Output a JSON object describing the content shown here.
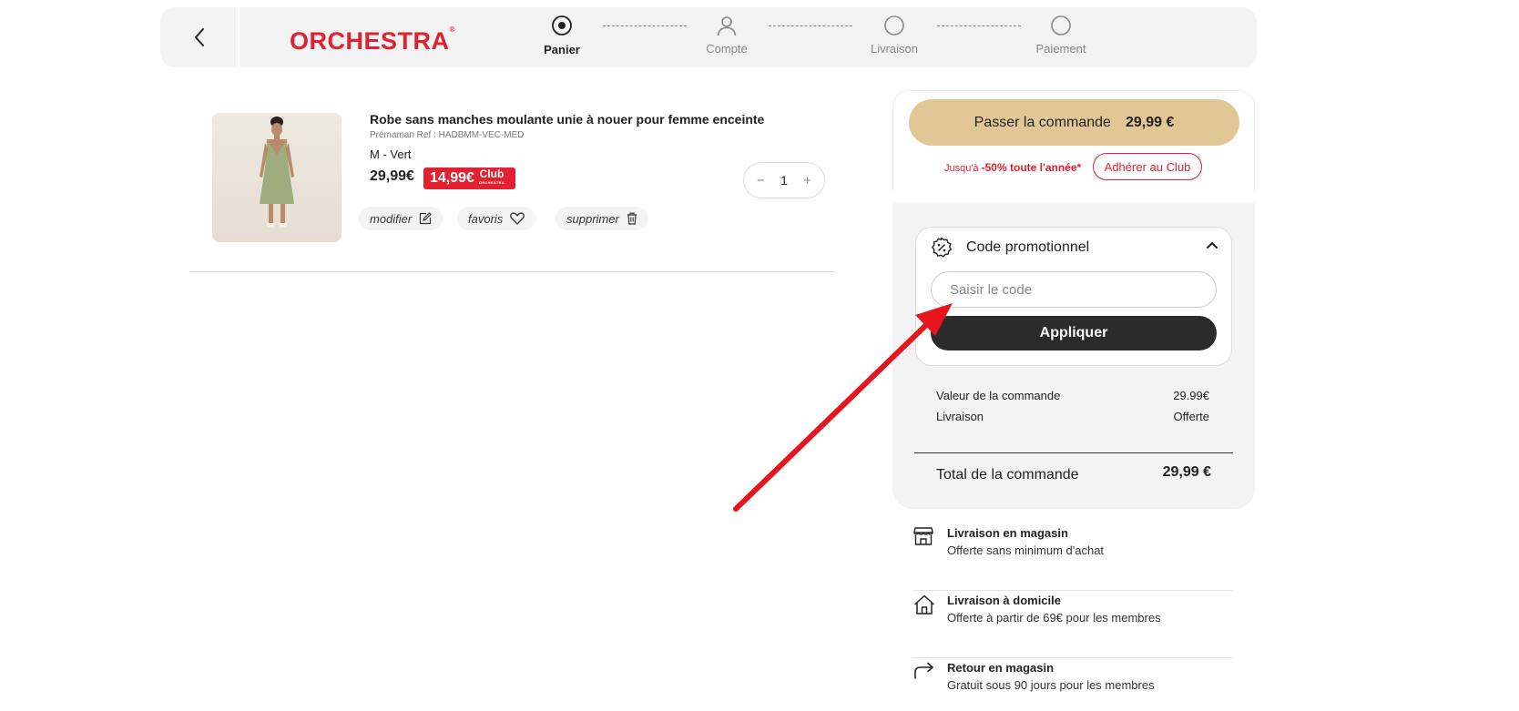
{
  "header": {
    "back_label": "Retour",
    "logo": "ORCHESTRA",
    "logo_mark": "®",
    "steps": [
      {
        "label": "Panier",
        "state": "active"
      },
      {
        "label": "Compte",
        "state": "inactive"
      },
      {
        "label": "Livraison",
        "state": "inactive"
      },
      {
        "label": "Paiement",
        "state": "inactive"
      }
    ]
  },
  "cart_item": {
    "title": "Robe sans manches moulante unie à nouer pour femme enceinte",
    "ref": "Prémaman Ref : HADBMM-VEC-MED",
    "variant": "M - Vert",
    "price": "29,99€",
    "club_price": "14,99€",
    "club_tag": "Club",
    "club_tag_brand": "ORCHESTRA",
    "quantity": "1",
    "qty_minus": "−",
    "qty_plus": "+",
    "actions": {
      "modify": "modifier",
      "favorites": "favoris",
      "remove": "supprimer"
    }
  },
  "checkout": {
    "button_label": "Passer la commande",
    "button_amount": "29,99 €",
    "club_promo_prefix": "Jusqu'à",
    "club_promo_highlight": "-50% toute l'année*",
    "club_button": "Adhérer au Club"
  },
  "promo": {
    "title": "Code promotionnel",
    "input_placeholder": "Saisir le code",
    "input_value": "",
    "apply_label": "Appliquer"
  },
  "summary": {
    "rows": [
      {
        "label": "Valeur de la commande",
        "value": "29.99€"
      },
      {
        "label": "Livraison",
        "value": "Offerte"
      }
    ],
    "total_label": "Total de la commande",
    "total_value": "29,99 €"
  },
  "services": [
    {
      "icon": "store-icon",
      "title": "Livraison en magasin",
      "subtitle": "Offerte sans minimum d'achat"
    },
    {
      "icon": "home-icon",
      "title": "Livraison à domicile",
      "subtitle": "Offerte à partir de 69€ pour les membres"
    },
    {
      "icon": "return-arrow-icon",
      "title": "Retour en magasin",
      "subtitle": "Gratuit sous 90 jours pour les membres"
    }
  ],
  "colors": {
    "brand_red": "#e3202f",
    "checkout_gold": "#e2c796",
    "panel_grey": "#f3f3f3",
    "apply_dark": "#2b2b2b",
    "annotation_arrow": "#e8141c"
  }
}
